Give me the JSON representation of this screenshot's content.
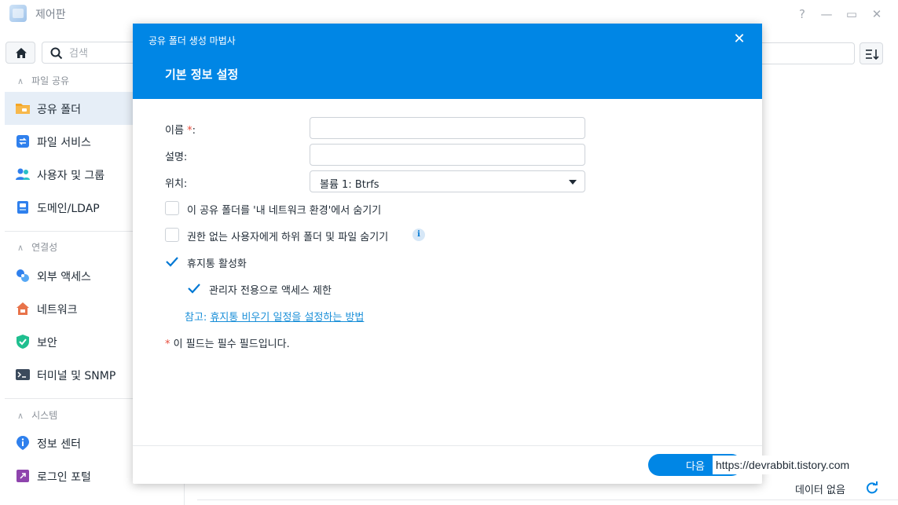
{
  "window": {
    "title": "제어판",
    "controls": {
      "help": "?",
      "minimize": "—",
      "maximize": "▭",
      "close": "✕"
    }
  },
  "sidebar": {
    "search_placeholder": "검색",
    "sections": [
      {
        "title": "파일 공유",
        "items": [
          {
            "label": "공유 폴더",
            "icon": "folder-share-icon",
            "active": true
          },
          {
            "label": "파일 서비스",
            "icon": "file-services-icon"
          },
          {
            "label": "사용자 및 그룹",
            "icon": "users-icon"
          },
          {
            "label": "도메인/LDAP",
            "icon": "domain-icon"
          }
        ]
      },
      {
        "title": "연결성",
        "items": [
          {
            "label": "외부 액세스",
            "icon": "external-access-icon"
          },
          {
            "label": "네트워크",
            "icon": "network-icon"
          },
          {
            "label": "보안",
            "icon": "shield-icon"
          },
          {
            "label": "터미널 및 SNMP",
            "icon": "terminal-icon"
          }
        ]
      },
      {
        "title": "시스템",
        "items": [
          {
            "label": "정보 센터",
            "icon": "info-center-icon"
          },
          {
            "label": "로그인 포털",
            "icon": "login-portal-icon"
          }
        ]
      }
    ]
  },
  "main": {
    "status_text": "데이터 없음"
  },
  "wizard": {
    "title": "공유 폴더 생성 마법사",
    "step_title": "기본 정보 설정",
    "fields": {
      "name_label": "이름",
      "name_required_mark": "*",
      "name_suffix": ":",
      "name_value": "",
      "description_label": "설명:",
      "description_value": "",
      "location_label": "위치:",
      "location_value": "볼륨 1:  Btrfs"
    },
    "options": {
      "hide_network": {
        "label": "이 공유 폴더를 '내 네트워크 환경'에서 숨기기",
        "checked": false
      },
      "hide_subfolders": {
        "label": "권한 없는 사용자에게 하위 폴더 및 파일 숨기기",
        "checked": false
      },
      "recycle_bin": {
        "label": "휴지통 활성화",
        "checked": true
      },
      "admin_only": {
        "label": "관리자 전용으로 액세스 제한",
        "checked": true
      }
    },
    "note_prefix": "참고:",
    "note_link": "휴지통 비우기 일정을 설정하는 방법",
    "required_mark": "*",
    "required_note": "이 필드는 필수 필드입니다.",
    "next_button": "다음"
  },
  "watermark": "https://devrabbit.tistory.com",
  "colors": {
    "accent": "#0086e5",
    "required": "#e74c3c",
    "link": "#1a8fd8"
  }
}
